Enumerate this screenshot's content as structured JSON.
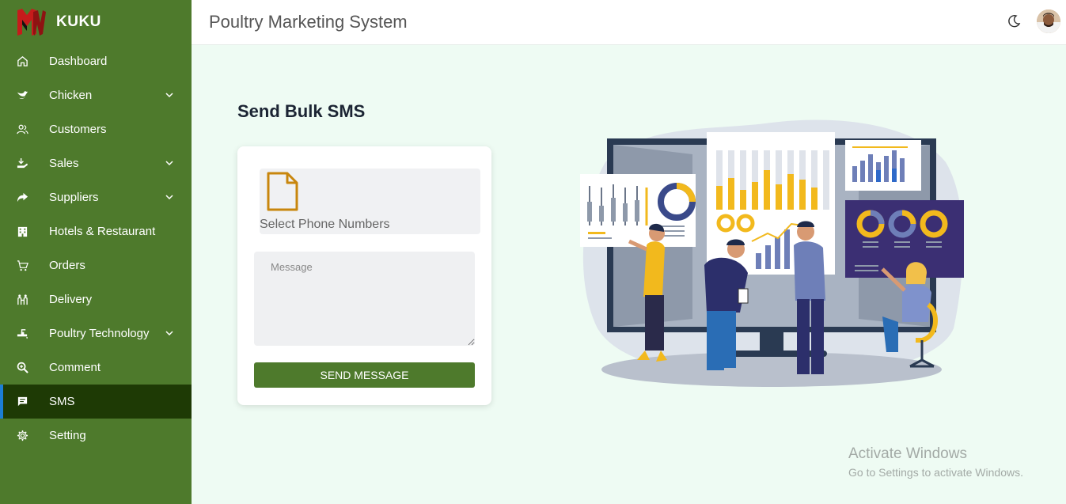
{
  "brand": {
    "name": "KUKU",
    "logo_color": "#c61b1b"
  },
  "header": {
    "title": "Poultry Marketing System",
    "theme_icon": "moon-icon"
  },
  "sidebar": {
    "bg_color": "#4e7a2c",
    "active_bg": "#1e3a05",
    "items": [
      {
        "label": "Dashboard",
        "icon": "home-icon",
        "has_submenu": false
      },
      {
        "label": "Chicken",
        "icon": "bird-icon",
        "has_submenu": true
      },
      {
        "label": "Customers",
        "icon": "users-icon",
        "has_submenu": false
      },
      {
        "label": "Sales",
        "icon": "sales-icon",
        "has_submenu": true
      },
      {
        "label": "Suppliers",
        "icon": "share-icon",
        "has_submenu": true
      },
      {
        "label": "Hotels & Restaurant",
        "icon": "building-icon",
        "has_submenu": false
      },
      {
        "label": "Orders",
        "icon": "cart-icon",
        "has_submenu": false
      },
      {
        "label": "Delivery",
        "icon": "delivery-icon",
        "has_submenu": false
      },
      {
        "label": "Poultry Technology",
        "icon": "tech-icon",
        "has_submenu": true
      },
      {
        "label": "Comment",
        "icon": "search-plus-icon",
        "has_submenu": false
      },
      {
        "label": "SMS",
        "icon": "message-icon",
        "has_submenu": false,
        "active": true
      },
      {
        "label": "Setting",
        "icon": "gear-icon",
        "has_submenu": false
      }
    ]
  },
  "main": {
    "title": "Send Bulk SMS",
    "file_label": "Select Phone Numbers",
    "message_placeholder": "Message",
    "message_value": "",
    "send_label": "SEND MESSAGE"
  },
  "watermark": {
    "title": "Activate Windows",
    "subtitle": "Go to Settings to activate Windows."
  }
}
